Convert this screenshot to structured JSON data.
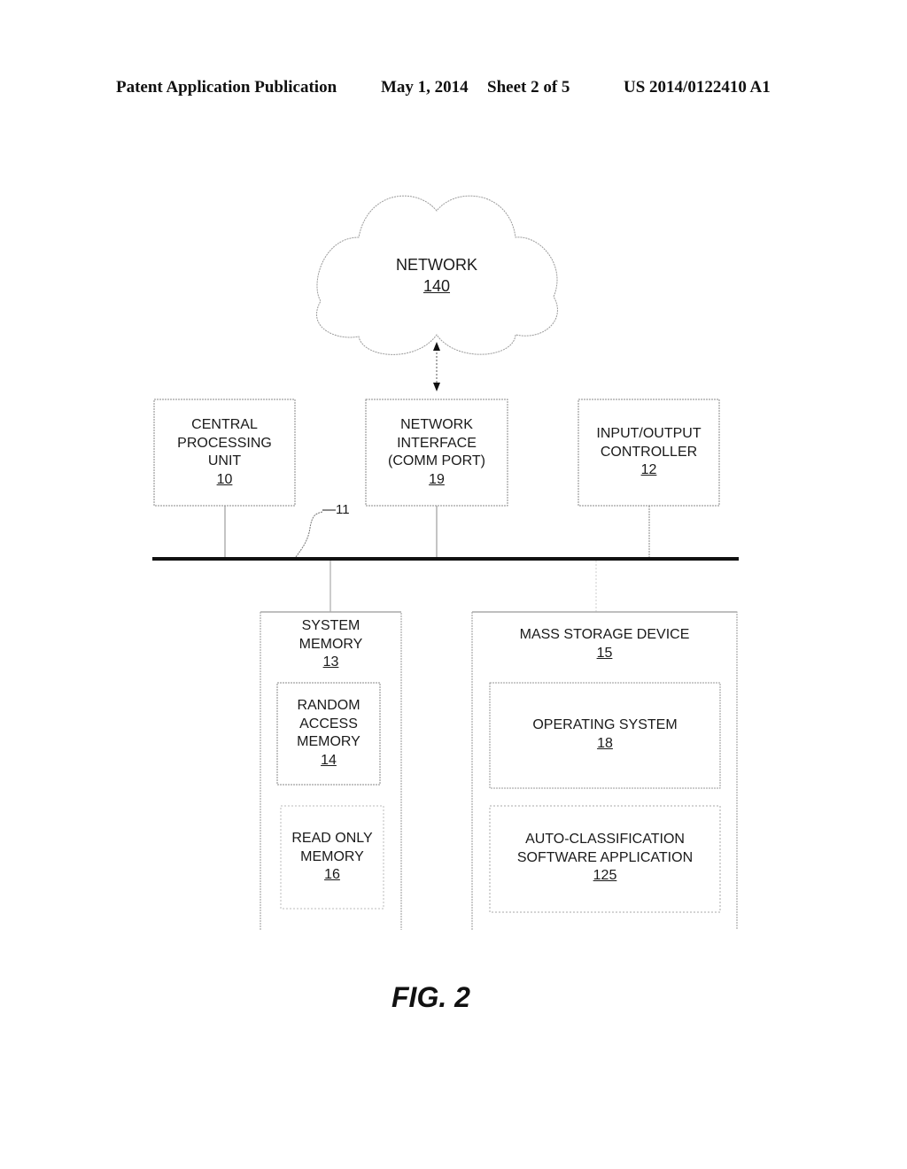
{
  "header": {
    "publication": "Patent Application Publication",
    "date": "May 1, 2014",
    "sheet": "Sheet 2 of 5",
    "number": "US 2014/0122410 A1"
  },
  "network": {
    "lines": [
      "NETWORK"
    ],
    "ref": "140"
  },
  "bus": {
    "ref": "—11"
  },
  "blocks": {
    "cpu": {
      "lines": [
        "CENTRAL",
        "PROCESSING",
        "UNIT"
      ],
      "ref": "10"
    },
    "nic": {
      "lines": [
        "NETWORK",
        "INTERFACE",
        "(COMM PORT)"
      ],
      "ref": "19"
    },
    "io": {
      "lines": [
        "INPUT/OUTPUT",
        "CONTROLLER"
      ],
      "ref": "12"
    },
    "sysmem": {
      "lines": [
        "SYSTEM",
        "MEMORY"
      ],
      "ref": "13"
    },
    "ram": {
      "lines": [
        "RANDOM",
        "ACCESS",
        "MEMORY"
      ],
      "ref": "14"
    },
    "rom": {
      "lines": [
        "READ ONLY",
        "MEMORY"
      ],
      "ref": "16"
    },
    "mass": {
      "lines": [
        "MASS STORAGE DEVICE"
      ],
      "ref": "15"
    },
    "os": {
      "lines": [
        "OPERATING SYSTEM"
      ],
      "ref": "18"
    },
    "app": {
      "lines": [
        "AUTO-CLASSIFICATION",
        "SOFTWARE APPLICATION"
      ],
      "ref": "125"
    }
  },
  "figure_label": "FIG. 2"
}
